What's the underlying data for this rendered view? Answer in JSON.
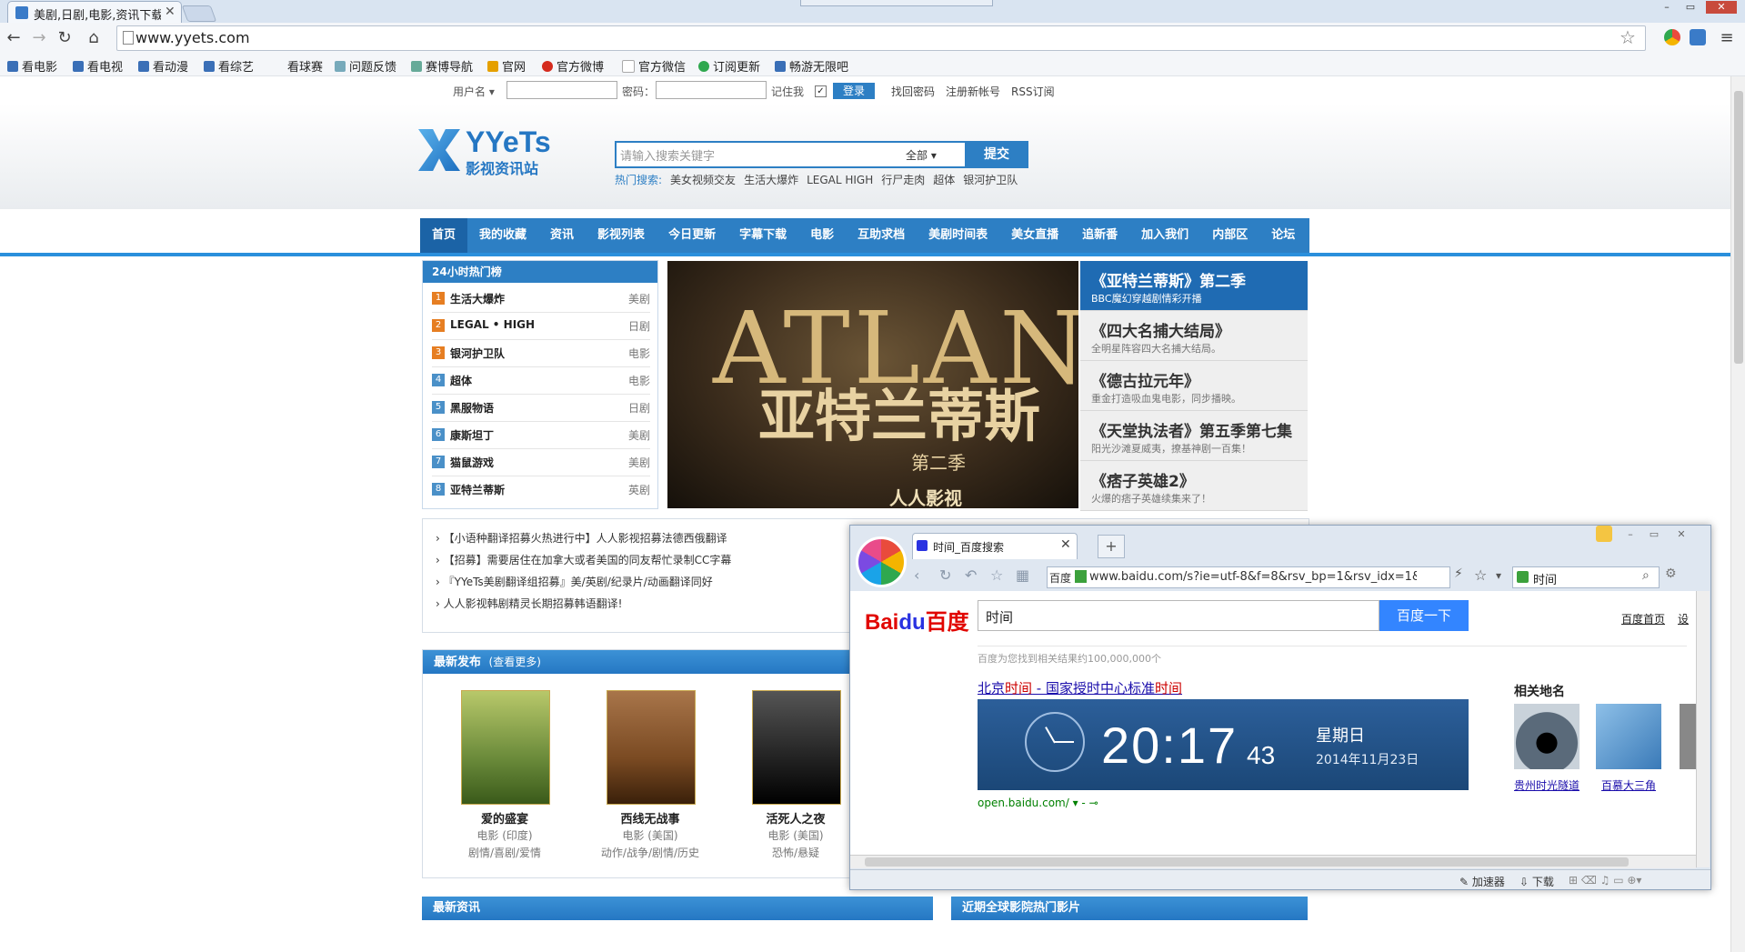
{
  "browser": {
    "tab_title": "美剧,日剧,电影,资讯下载",
    "url": "www.yyets.com",
    "window_controls": [
      "–",
      "▭",
      "✕"
    ]
  },
  "bookmarks": [
    {
      "label": "看电影",
      "icon": "film-icon",
      "color": "#3a6fb7"
    },
    {
      "label": "看电视",
      "icon": "tv-icon",
      "color": "#3a6fb7"
    },
    {
      "label": "看动漫",
      "icon": "anime-icon",
      "color": "#3a6fb7"
    },
    {
      "label": "看综艺",
      "icon": "variety-icon",
      "color": "#3a6fb7"
    },
    {
      "label": "看球赛",
      "icon": "",
      "color": ""
    },
    {
      "label": "问题反馈",
      "icon": "feedback-icon",
      "color": "#7ab"
    },
    {
      "label": "赛博导航",
      "icon": "nav-icon",
      "color": "#6a9"
    },
    {
      "label": "官网",
      "icon": "site-icon",
      "color": "#e5a000"
    },
    {
      "label": "官方微博",
      "icon": "weibo-icon",
      "color": "#d52b1e"
    },
    {
      "label": "官方微信",
      "icon": "doc-icon",
      "color": "#cccccc"
    },
    {
      "label": "订阅更新",
      "icon": "chrome-icon",
      "color": "#2fa84f"
    },
    {
      "label": "畅游无限吧",
      "icon": "game-icon",
      "color": "#3a6fb7"
    }
  ],
  "login": {
    "username_label": "用户名",
    "password_label": "密码：",
    "remember_label": "记住我",
    "login_button": "登录",
    "links": [
      "找回密码",
      "注册新帐号",
      "RSS订阅"
    ]
  },
  "logo": {
    "title": "YYeTs",
    "subtitle": "影视资讯站"
  },
  "search": {
    "placeholder": "请输入搜索关键字",
    "scope": "全部",
    "button": "提交",
    "hot_label": "热门搜索:",
    "hot_items": [
      "美女视频交友",
      "生活大爆炸",
      "LEGAL HIGH",
      "行尸走肉",
      "超体",
      "银河护卫队"
    ]
  },
  "nav": [
    "首页",
    "我的收藏",
    "资讯",
    "影视列表",
    "今日更新",
    "字幕下载",
    "电影",
    "互助求档",
    "美剧时间表",
    "美女直播",
    "追新番",
    "加入我们",
    "内部区",
    "论坛"
  ],
  "hot24": {
    "title": "24小时热门榜",
    "items": [
      {
        "rank": "1",
        "name": "生活大爆炸",
        "cat": "美剧",
        "color": "#e67e22"
      },
      {
        "rank": "2",
        "name": "LEGAL • HIGH",
        "cat": "日剧",
        "color": "#e67e22"
      },
      {
        "rank": "3",
        "name": "银河护卫队",
        "cat": "电影",
        "color": "#e67e22"
      },
      {
        "rank": "4",
        "name": "超体",
        "cat": "电影",
        "color": "#4a90c8"
      },
      {
        "rank": "5",
        "name": "黑服物语",
        "cat": "日剧",
        "color": "#4a90c8"
      },
      {
        "rank": "6",
        "name": "康斯坦丁",
        "cat": "美剧",
        "color": "#4a90c8"
      },
      {
        "rank": "7",
        "name": "猫鼠游戏",
        "cat": "美剧",
        "color": "#4a90c8"
      },
      {
        "rank": "8",
        "name": "亚特兰蒂斯",
        "cat": "英剧",
        "color": "#4a90c8"
      }
    ]
  },
  "banner": {
    "title_en": "ATLANT",
    "title_cn": "亚特兰蒂斯",
    "season": "第二季",
    "brand": "人人影视",
    "side": [
      {
        "title": "《亚特兰蒂斯》第二季",
        "sub": "BBC魔幻穿越剧情彩开播"
      },
      {
        "title": "《四大名捕大结局》",
        "sub": "全明星阵容四大名捕大结局。"
      },
      {
        "title": "《德古拉元年》",
        "sub": "重金打造吸血鬼电影，同步播映。"
      },
      {
        "title": "《天堂执法者》第五季第七集",
        "sub": "阳光沙滩夏威夷，撩基神剧一百集！"
      },
      {
        "title": "《痞子英雄2》",
        "sub": "火爆的痞子英雄续集来了！"
      }
    ]
  },
  "notices": [
    "【小语种翻译招募火热进行中】人人影视招募法德西俄翻译",
    "【招募】需要居住在加拿大或者美国的同友帮忙录制CC字幕",
    "『YYeTs美剧翻译组招募』美/英剧/纪录片/动画翻译同好",
    "人人影视韩剧精灵长期招募韩语翻译!"
  ],
  "latest": {
    "title": "最新发布",
    "more": "(查看更多)",
    "items": [
      {
        "title": "爱的盛宴",
        "type": "电影 (印度)",
        "genre": "剧情/喜剧/爱情",
        "poster_color": "#6a8a3a"
      },
      {
        "title": "西线无战事",
        "type": "电影 (美国)",
        "genre": "动作/战争/剧情/历史",
        "poster_color": "#7a4a22"
      },
      {
        "title": "活死人之夜",
        "type": "电影 (美国)",
        "genre": "恐怖/悬疑",
        "poster_color": "#222222"
      }
    ]
  },
  "sections": {
    "news": "最新资讯",
    "cinema": "近期全球影院热门影片"
  },
  "popup": {
    "tab_title": "时间_百度搜索",
    "address_label": "百度",
    "url": "www.baidu.com/s?ie=utf-8&f=8&rsv_bp=1&rsv_idx=1&",
    "search_value": "时间",
    "baidu": {
      "logo_bai": "Bai",
      "logo_du": "du",
      "logo_cn": "百度",
      "query": "时间",
      "button": "百度一下",
      "links": [
        "百度首页",
        "设"
      ],
      "count": "百度为您找到相关结果约100,000,000个",
      "result_title_pre": "北京",
      "result_title_em1": "时间",
      "result_title_mid": " - 国家授时中心标准",
      "result_title_em2": "时间",
      "clock_time": "20:17",
      "clock_secs": "43",
      "weekday": "星期日",
      "date": "2014年11月23日",
      "source": "open.baidu.com/ ▾ - ⊸",
      "related_head": "相关地名",
      "related": [
        {
          "name": "贵州时光隧道",
          "color": "#3b4a5a"
        },
        {
          "name": "百慕大三角",
          "color": "#3a7ab8"
        }
      ]
    },
    "status": [
      "加速器",
      "下载"
    ]
  }
}
